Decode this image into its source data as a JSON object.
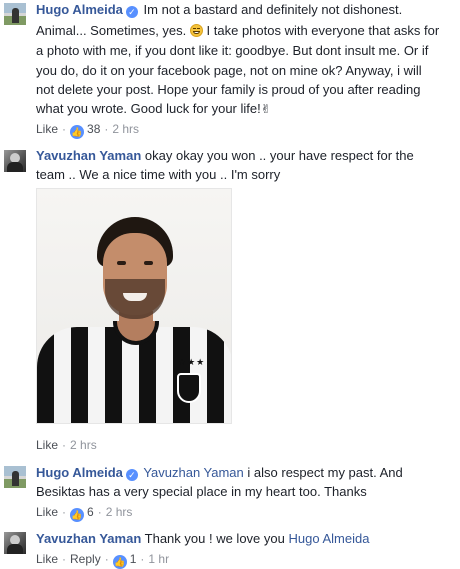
{
  "comments": [
    {
      "author": "Hugo Almeida",
      "verified": true,
      "lines": [
        "Im not a bastard and definitely not dishonest.",
        "Animal... Sometimes, yes.",
        "I take photos with everyone that asks for",
        "a photo with me, if you dont like it: goodbye. But dont insult me. Or if",
        "you do, do it on your facebook page, not on mine ok? Anyway, i will",
        "not delete your post. Hope your family is proud of you after reading",
        "what you wrote. Good luck for your life!"
      ],
      "emoji_icon": "grinning-sweat-emoji-icon",
      "end_icon": "victory-hand-icon",
      "end_glyph": "✌",
      "meta": {
        "like": "Like",
        "reactions": "38",
        "time": "2 hrs"
      }
    },
    {
      "author": "Yavuzhan Yaman",
      "verified": false,
      "lines": [
        "okay okay you won .. your have respect for the",
        "team .. We a nice time with you .. I'm sorry"
      ],
      "photo_icon": "player-photo-image",
      "meta": {
        "like": "Like",
        "time": "2 hrs"
      }
    },
    {
      "author": "Hugo Almeida",
      "verified": true,
      "mention": "Yavuzhan Yaman",
      "lines": [
        "i also respect my past. And",
        "Besiktas has a very special place in my heart too. Thanks"
      ],
      "meta": {
        "like": "Like",
        "reactions": "6",
        "time": "2 hrs"
      }
    },
    {
      "author": "Yavuzhan Yaman",
      "verified": false,
      "text": "Thank you ! we love you",
      "mention": "Hugo Almeida",
      "meta": {
        "like": "Like",
        "reply": "Reply",
        "reactions": "1",
        "time": "1 hr"
      }
    }
  ],
  "colors": {
    "name": "#365899",
    "meta": "#90949c",
    "like_badge": "#5890ff"
  }
}
